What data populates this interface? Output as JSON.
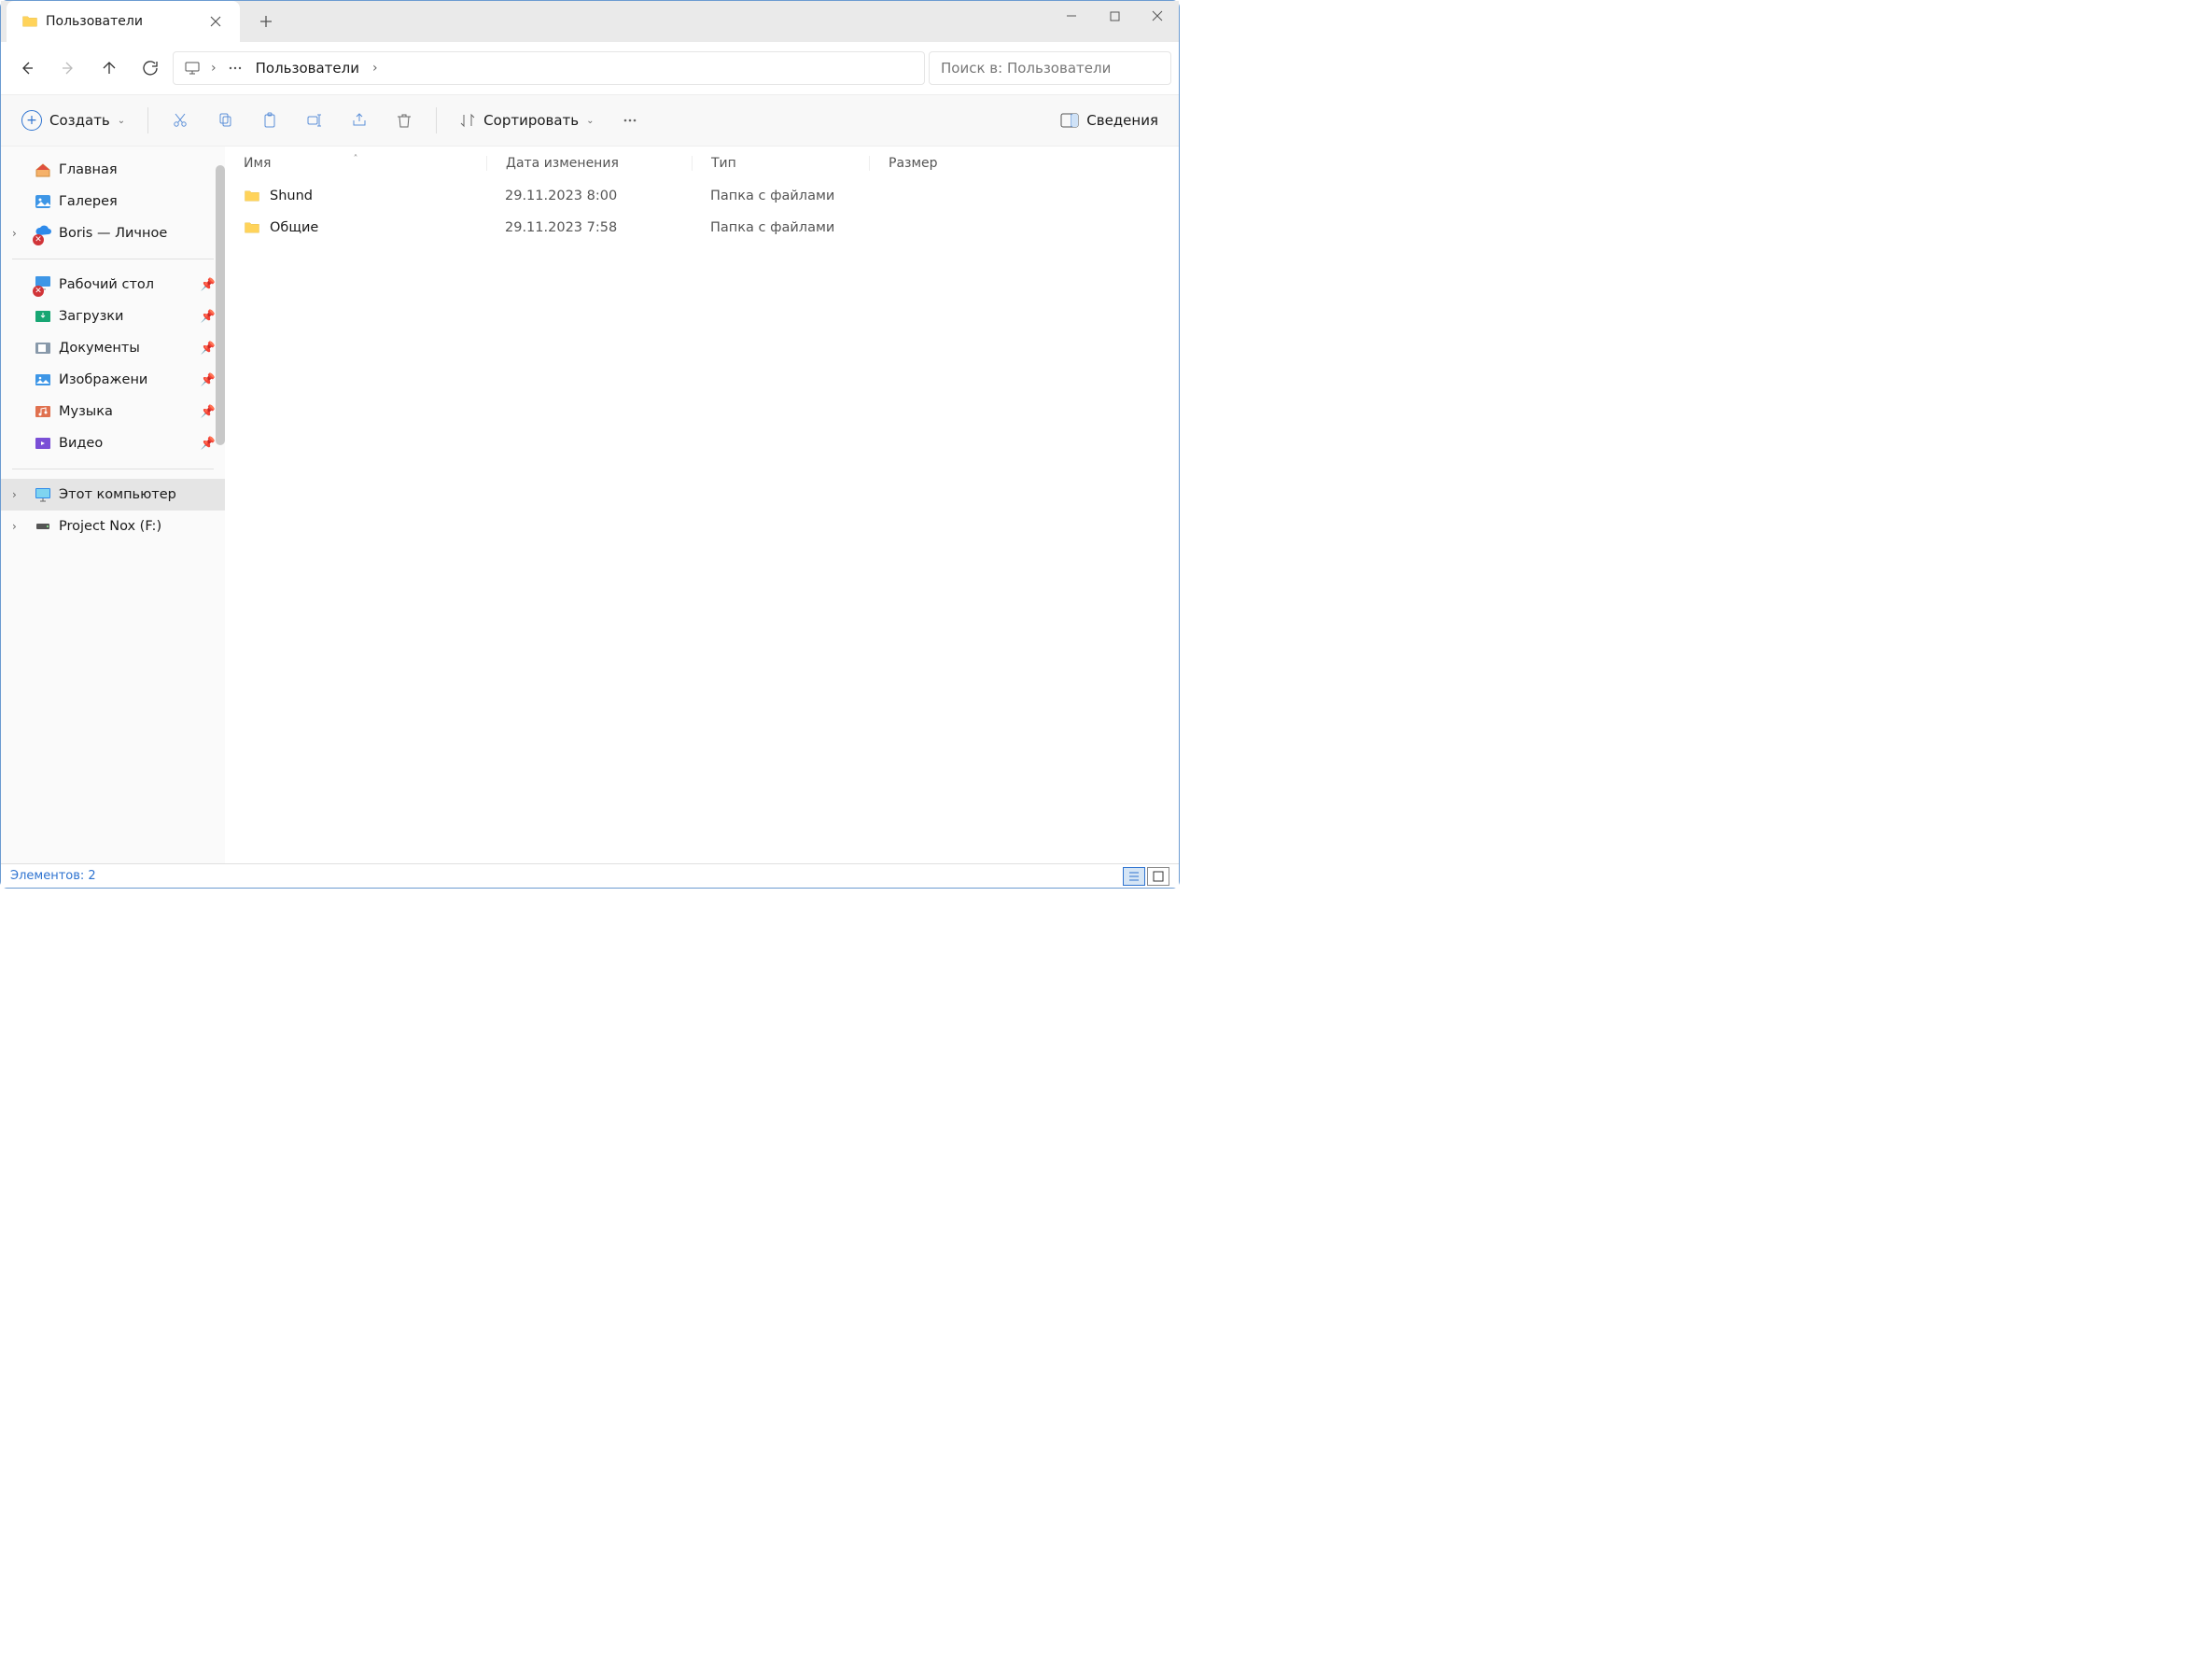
{
  "tab": {
    "title": "Пользователи"
  },
  "breadcrumb": {
    "current": "Пользователи"
  },
  "search": {
    "placeholder": "Поиск в: Пользователи"
  },
  "toolbar": {
    "create": "Создать",
    "sort": "Сортировать",
    "details": "Сведения"
  },
  "sidebar": {
    "home": "Главная",
    "gallery": "Галерея",
    "onedrive": "Boris — Личное",
    "desktop": "Рабочий стол",
    "downloads": "Загрузки",
    "documents": "Документы",
    "pictures": "Изображени",
    "music": "Музыка",
    "videos": "Видео",
    "this_pc": "Этот компьютер",
    "drive_f": "Project Nox (F:)"
  },
  "columns": {
    "name": "Имя",
    "date": "Дата изменения",
    "type": "Тип",
    "size": "Размер"
  },
  "rows": [
    {
      "name": "Shund",
      "date": "29.11.2023 8:00",
      "type": "Папка с файлами",
      "size": ""
    },
    {
      "name": "Общие",
      "date": "29.11.2023 7:58",
      "type": "Папка с файлами",
      "size": ""
    }
  ],
  "status": {
    "text": "Элементов: 2"
  }
}
